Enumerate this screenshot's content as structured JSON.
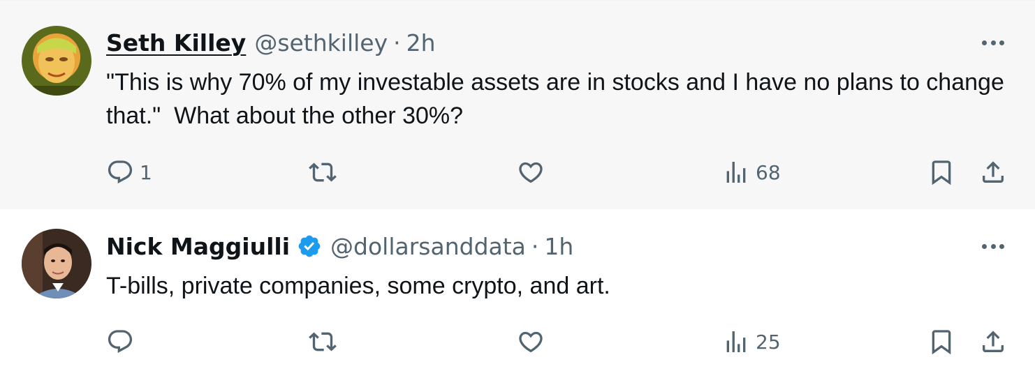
{
  "tweets": [
    {
      "name": "Seth Killey",
      "handle": "@sethkilley",
      "separator": "·",
      "time": "2h",
      "text": "\"This is why 70% of my investable assets are in stocks and I have no plans to change that.\"  What about the other 30%?",
      "verified": false,
      "actions": {
        "replies": "1",
        "retweets": "",
        "likes": "",
        "views": "68"
      }
    },
    {
      "name": "Nick Maggiulli",
      "handle": "@dollarsanddata",
      "separator": "·",
      "time": "1h",
      "text": "T-bills, private companies, some crypto, and art.",
      "verified": true,
      "actions": {
        "replies": "",
        "retweets": "",
        "likes": "",
        "views": "25"
      }
    }
  ],
  "colors": {
    "verified_badge": "#1d9bf0",
    "secondary_text": "#536471",
    "thread_line": "#cfd9de",
    "highlight_background": "#f7f7f7"
  },
  "icons": [
    "reply-icon",
    "retweet-icon",
    "like-icon",
    "views-icon",
    "bookmark-icon",
    "share-icon",
    "more-icon",
    "verified-icon"
  ]
}
